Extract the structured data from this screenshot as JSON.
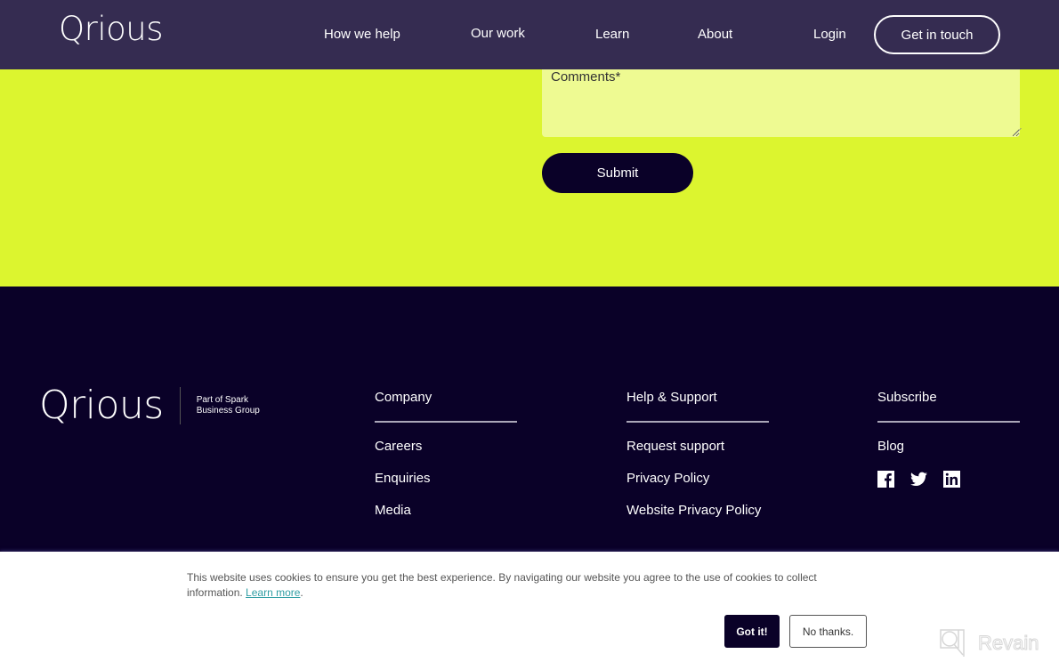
{
  "header": {
    "logo": "Qrious",
    "nav": [
      {
        "label": "How we help"
      },
      {
        "label": "Our work"
      },
      {
        "label": "Learn"
      },
      {
        "label": "About"
      },
      {
        "label": "Login"
      }
    ],
    "cta_label": "Get in touch"
  },
  "form": {
    "comments_label": "Comments*",
    "comments_value": "",
    "submit_label": "Submit"
  },
  "footer": {
    "logo": "Qrious",
    "tagline_line1": "Part of Spark",
    "tagline_line2": "Business Group",
    "columns": [
      {
        "heading": "Company",
        "links": [
          "Careers",
          "Enquiries",
          "Media"
        ]
      },
      {
        "heading": "Help & Support",
        "links": [
          "Request support",
          "Privacy Policy",
          "Website Privacy Policy"
        ]
      },
      {
        "heading": "Subscribe",
        "links": [
          "Blog"
        ]
      }
    ],
    "social": [
      "facebook-icon",
      "twitter-icon",
      "linkedin-icon"
    ]
  },
  "cookie": {
    "message": "This website uses cookies to ensure you get the best experience. By navigating our website you agree to the use of cookies to collect information.",
    "learn_more": "Learn more",
    "accept_label": "Got it!",
    "decline_label": "No thanks."
  },
  "watermark": "Revain",
  "colors": {
    "header_bg": "#352c51",
    "accent_lime": "#dcf52f",
    "footer_bg": "#0a0128",
    "link_teal": "#2f9da3"
  }
}
